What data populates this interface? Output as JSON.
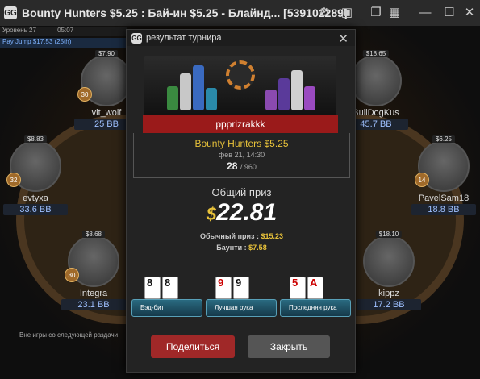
{
  "window": {
    "title": "Bounty Hunters $5.25 : Бай-ин $5.25 - Блайнд... [539102289]"
  },
  "table_info": {
    "level": "Уровень 27",
    "time": "05:07",
    "pay_jump": "Pay Jump  $17.53 (25th)"
  },
  "players": [
    {
      "name": "vit_wolf",
      "stack": "$7.90",
      "bb": "25 BB",
      "bounty": "30"
    },
    {
      "name": "BullDogKus",
      "stack": "$18.65",
      "bb": "45.7 BB"
    },
    {
      "name": "evtyxa",
      "stack": "$8.83",
      "bb": "33.6 BB",
      "bounty": "32"
    },
    {
      "name": "PavelSam18",
      "stack": "$6.25",
      "bb": "18.8 BB",
      "bounty": "14"
    },
    {
      "name": "Integra",
      "stack": "$8.68",
      "bb": "23.1 BB",
      "bounty": "30"
    },
    {
      "name": "kippz",
      "stack": "$18.10",
      "bb": "17.2 BB"
    }
  ],
  "bottom_note": "Вне игры со следующей раздачи",
  "modal": {
    "title": "результат турнира",
    "player": "ppprizrakkk",
    "tournament_name": "Bounty Hunters $5.25",
    "date": "фев 21, 14:30",
    "place": "28",
    "of": "/ 960",
    "total_label": "Общий приз",
    "currency": "$",
    "total_amount": "22.81",
    "regular_label": "Обычный приз :",
    "regular_value": "$15.23",
    "bounty_label": "Баунти :",
    "bounty_value": "$7.58",
    "hands": [
      {
        "label": "Бэд-бит",
        "cards": [
          {
            "rank": "8",
            "color": "black"
          },
          {
            "rank": "8",
            "color": "black"
          }
        ]
      },
      {
        "label": "Лучшая рука",
        "cards": [
          {
            "rank": "9",
            "color": "red"
          },
          {
            "rank": "9",
            "color": "black"
          }
        ]
      },
      {
        "label": "Последняя рука",
        "cards": [
          {
            "rank": "5",
            "color": "red"
          },
          {
            "rank": "A",
            "color": "red"
          }
        ]
      }
    ],
    "share_label": "Поделиться",
    "close_label": "Закрыть"
  },
  "colors": {
    "accent": "#e8c23a",
    "share": "#a02828",
    "ribbon": "#9a1a1a"
  }
}
